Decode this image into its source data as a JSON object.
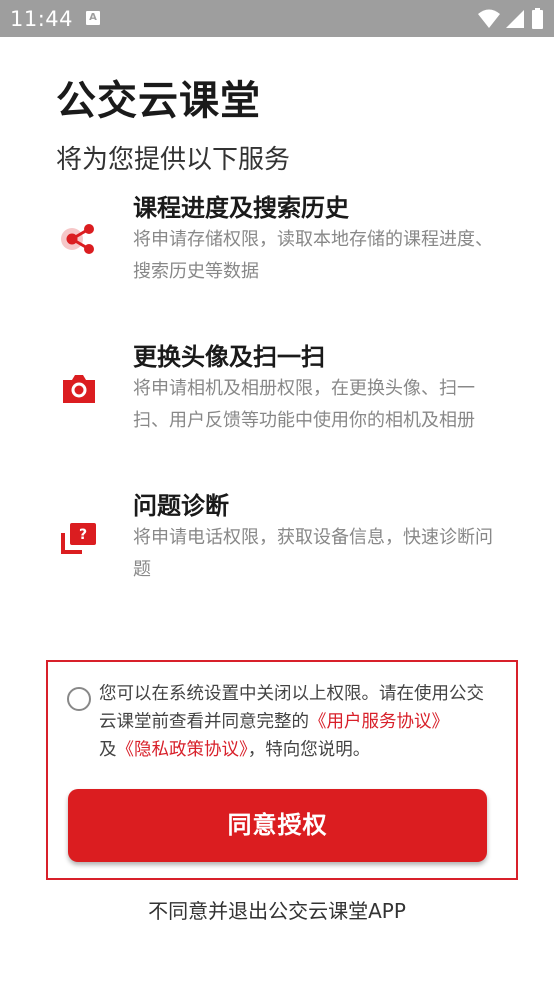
{
  "status_bar": {
    "time": "11:44",
    "notification_badge": "A",
    "icons": [
      "wifi-icon",
      "signal-icon",
      "battery-icon"
    ]
  },
  "page": {
    "title": "公交云课堂",
    "subtitle": "将为您提供以下服务"
  },
  "permissions": [
    {
      "icon": "share-icon",
      "title": "课程进度及搜索历史",
      "description": "将申请存储权限，读取本地存储的课程进度、搜索历史等数据"
    },
    {
      "icon": "camera-icon",
      "title": "更换头像及扫一扫",
      "description": "将申请相机及相册权限，在更换头像、扫一扫、用户反馈等功能中使用你的相机及相册"
    },
    {
      "icon": "help-chat-icon",
      "title": "问题诊断",
      "description": "将申请电话权限，获取设备信息，快速诊断问题"
    }
  ],
  "consent": {
    "checked": false,
    "text_part1": "您可以在系统设置中关闭以上权限。请在使用公交云课堂前查看并同意完整的",
    "user_agreement_link": "《用户服务协议》",
    "text_part2": "及",
    "privacy_link": "《隐私政策协议》",
    "text_part3": "，特向您说明。",
    "agree_button": "同意授权"
  },
  "exit_link": "不同意并退出公交云课堂APP",
  "colors": {
    "accent": "#db1d20",
    "border_highlight": "#d8202a",
    "status_bar": "#9e9e9e",
    "description_text": "#888888"
  }
}
